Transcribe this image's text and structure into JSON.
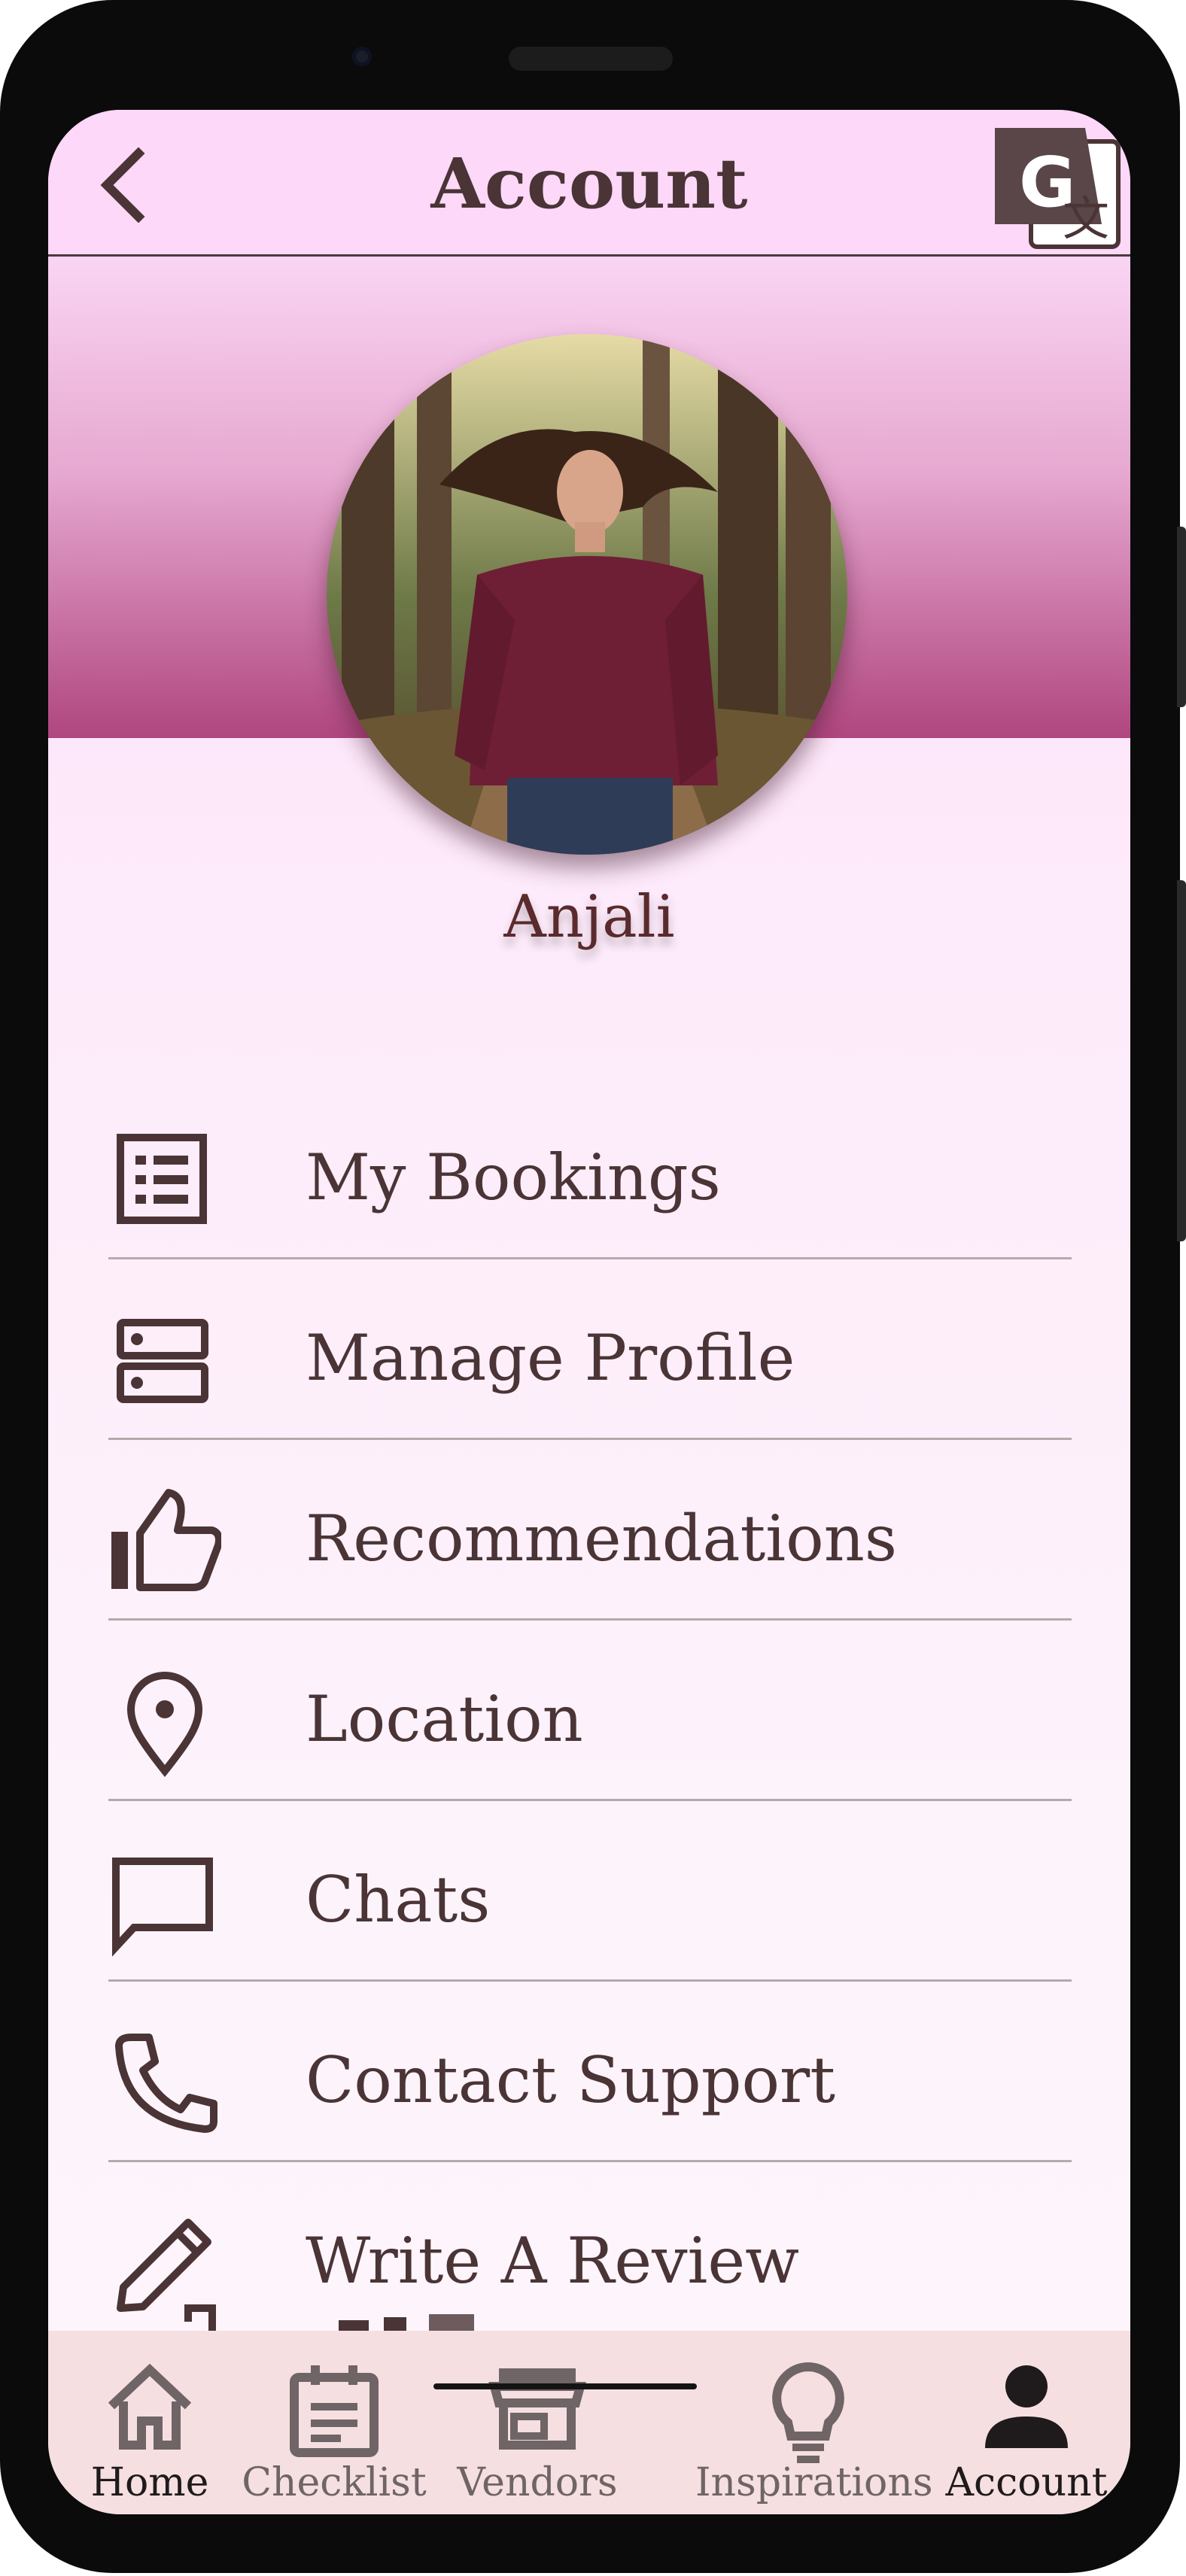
{
  "header": {
    "title": "Account",
    "back_icon": "chevron-left-icon",
    "translate_icon": "google-translate-icon"
  },
  "profile": {
    "name": "Anjali",
    "avatar": "profile-photo"
  },
  "menu": [
    {
      "label": "My Bookings",
      "icon": "list-icon"
    },
    {
      "label": "Manage Profile",
      "icon": "dns-icon"
    },
    {
      "label": "Recommendations",
      "icon": "thumbs-up-icon"
    },
    {
      "label": "Location",
      "icon": "location-pin-icon"
    },
    {
      "label": "Chats",
      "icon": "chat-bubble-icon"
    },
    {
      "label": "Contact Support",
      "icon": "phone-icon"
    },
    {
      "label": "Write A Review",
      "icon": "pencil-icon"
    }
  ],
  "bottom_nav": [
    {
      "label": "Home",
      "icon": "home-icon",
      "active": true
    },
    {
      "label": "Checklist",
      "icon": "checklist-icon",
      "active": false
    },
    {
      "label": "Vendors",
      "icon": "store-icon",
      "active": false
    },
    {
      "label": "Inspirations",
      "icon": "lightbulb-icon",
      "active": false
    },
    {
      "label": "Account",
      "icon": "person-icon",
      "active": true
    }
  ],
  "colors": {
    "header_bg": "#fdd8f8",
    "text": "#4a3436",
    "banner_bottom": "#b0467f",
    "nav_bg": "#f5dfe1"
  }
}
